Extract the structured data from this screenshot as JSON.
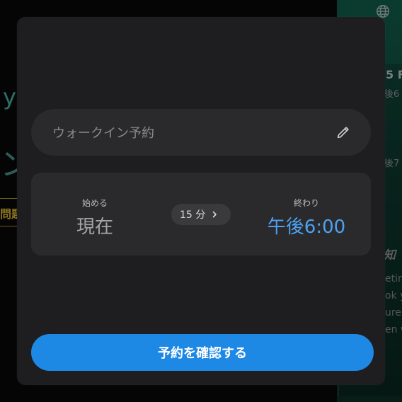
{
  "background": {
    "right_snippets": [
      "5 F",
      "後6",
      "後7",
      "知",
      "etin",
      "ok y",
      "ure",
      "en w"
    ],
    "left_snippets": [
      "y",
      "ン",
      "問題"
    ]
  },
  "modal": {
    "name_field": {
      "placeholder": "ウォークイン予約",
      "value": ""
    },
    "start": {
      "label": "始める",
      "value": "現在"
    },
    "duration": {
      "label": "15 分"
    },
    "end": {
      "label": "終わり",
      "value": "午後6:00"
    },
    "confirm_label": "予約を確認する"
  },
  "colors": {
    "modal_bg": "#1e1e20",
    "field_bg": "#2a2a2c",
    "accent": "#1e88e5",
    "end_time": "#4ea1f0"
  },
  "icons": {
    "edit": "pencil-icon",
    "duration_chevron": "chevron-right-icon",
    "language": "globe-icon"
  }
}
